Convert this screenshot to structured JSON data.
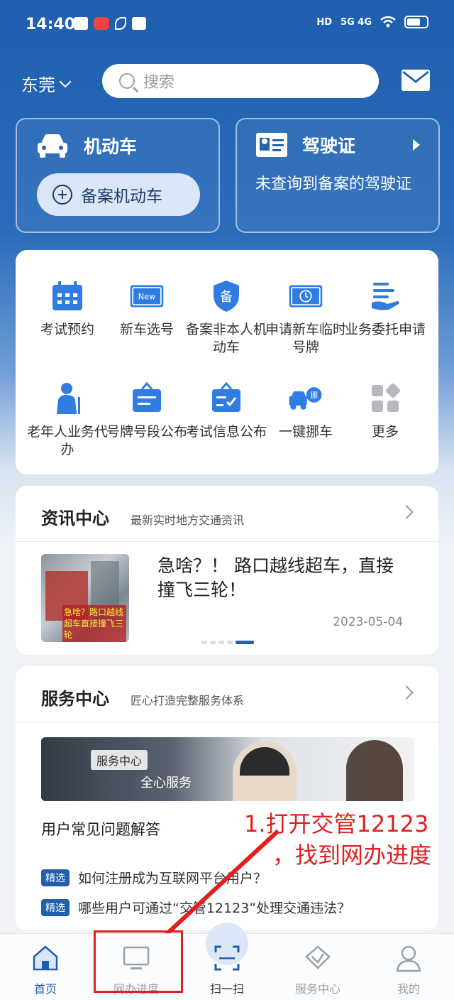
{
  "status_bar": {
    "time": "14:40",
    "signal": "5G 4G"
  },
  "header": {
    "city": "东莞",
    "search_placeholder": "搜索"
  },
  "vehicle_card": {
    "title": "机动车",
    "button_label": "备案机动车"
  },
  "license_card": {
    "title": "驾驶证",
    "message": "未查询到备案的驾驶证"
  },
  "services": [
    {
      "label": "考试预约",
      "icon": "calendar-icon"
    },
    {
      "label": "新车选号",
      "icon": "new-plate-icon",
      "badge": "New"
    },
    {
      "label": "备案非本人机动车",
      "icon": "shield-icon",
      "badge": "备"
    },
    {
      "label": "申请新车临时号牌",
      "icon": "clock-plate-icon"
    },
    {
      "label": "业务委托申请",
      "icon": "hand-list-icon"
    },
    {
      "label": "老年人业务代办",
      "icon": "elder-icon"
    },
    {
      "label": "号牌号段公布",
      "icon": "sign-icon"
    },
    {
      "label": "考试信息公布",
      "icon": "board-check-icon"
    },
    {
      "label": "一键挪车",
      "icon": "tow-truck-icon",
      "badge": "挪"
    },
    {
      "label": "更多",
      "icon": "more-icon"
    }
  ],
  "news": {
    "title": "资讯中心",
    "subtitle": "最新实时地方交通资讯",
    "headline": "急啥？！ 路口越线超车，直接撞飞三轮！",
    "date": "2023-05-04",
    "thumb_caption": "急啥？路口越线超车直接撞飞三轮"
  },
  "service_center": {
    "title": "服务中心",
    "subtitle": "匠心打造完整服务体系",
    "banner_badge": "服务中心",
    "banner_text": "全心服务",
    "faq_title": "用户常见问题解答",
    "faq_tag": "精选",
    "questions": [
      "如何注册成为互联网平台用户？",
      "哪些用户可通过“交管12123”处理交通违法？"
    ]
  },
  "annotation": {
    "line1": "1.打开交管12123",
    "line2": "，找到网办进度"
  },
  "bottom_nav": [
    {
      "label": "首页",
      "icon": "home-icon",
      "active": true
    },
    {
      "label": "网办进度",
      "icon": "monitor-icon",
      "active": false
    },
    {
      "label": "扫一扫",
      "icon": "scan-icon",
      "active": false
    },
    {
      "label": "服务中心",
      "icon": "service-center-icon",
      "active": false
    },
    {
      "label": "我的",
      "icon": "user-icon",
      "active": false
    }
  ],
  "colors": {
    "primary": "#1f5fae",
    "annotation": "#e02020",
    "icon_blue": "#2f7de1"
  }
}
